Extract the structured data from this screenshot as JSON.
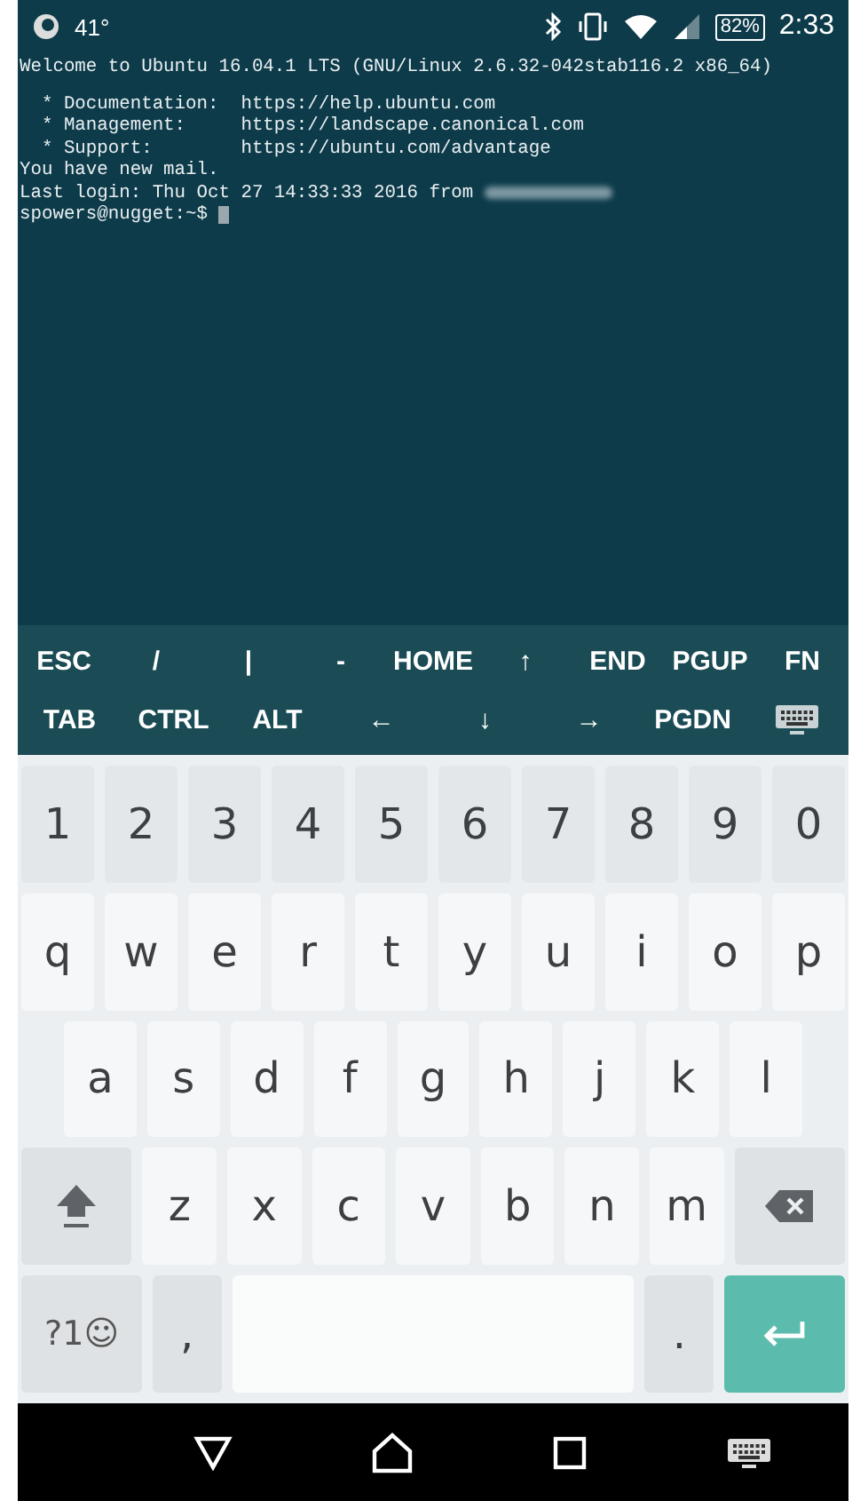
{
  "status_bar": {
    "temperature": "41°",
    "battery": "82%",
    "time": "2:33"
  },
  "terminal": {
    "welcome": "Welcome to Ubuntu 16.04.1 LTS (GNU/Linux 2.6.32-042stab116.2 x86_64)",
    "lines": [
      "  * Documentation:  https://help.ubuntu.com",
      "  * Management:     https://landscape.canonical.com",
      "  * Support:        https://ubuntu.com/advantage",
      "You have new mail."
    ],
    "last_login": "Last login: Thu Oct 27 14:33:33 2016 from",
    "prompt": "spowers@nugget:~$"
  },
  "extra_keys": [
    [
      "ESC",
      "/",
      "|",
      "-",
      "HOME",
      "↑",
      "END",
      "PGUP",
      "FN"
    ],
    [
      "TAB",
      "CTRL",
      "ALT",
      "←",
      "↓",
      "→",
      "PGDN"
    ]
  ],
  "keyboard": [
    [
      {
        "kind": "char",
        "label": "1"
      },
      {
        "kind": "char",
        "label": "2"
      },
      {
        "kind": "char",
        "label": "3"
      },
      {
        "kind": "char",
        "label": "4"
      },
      {
        "kind": "char",
        "label": "5"
      },
      {
        "kind": "char",
        "label": "6"
      },
      {
        "kind": "char",
        "label": "7"
      },
      {
        "kind": "char",
        "label": "8"
      },
      {
        "kind": "char",
        "label": "9"
      },
      {
        "kind": "char",
        "label": "0"
      }
    ],
    [
      {
        "kind": "char",
        "label": "q"
      },
      {
        "kind": "char",
        "label": "w"
      },
      {
        "kind": "char",
        "label": "e"
      },
      {
        "kind": "char",
        "label": "r"
      },
      {
        "kind": "char",
        "label": "t"
      },
      {
        "kind": "char",
        "label": "y"
      },
      {
        "kind": "char",
        "label": "u"
      },
      {
        "kind": "char",
        "label": "i"
      },
      {
        "kind": "char",
        "label": "o"
      },
      {
        "kind": "char",
        "label": "p"
      }
    ],
    [
      {
        "kind": "char",
        "label": "a"
      },
      {
        "kind": "char",
        "label": "s"
      },
      {
        "kind": "char",
        "label": "d"
      },
      {
        "kind": "char",
        "label": "f"
      },
      {
        "kind": "char",
        "label": "g"
      },
      {
        "kind": "char",
        "label": "h"
      },
      {
        "kind": "char",
        "label": "j"
      },
      {
        "kind": "char",
        "label": "k"
      },
      {
        "kind": "char",
        "label": "l"
      }
    ],
    [
      {
        "kind": "shift"
      },
      {
        "kind": "char",
        "label": "z"
      },
      {
        "kind": "char",
        "label": "x"
      },
      {
        "kind": "char",
        "label": "c"
      },
      {
        "kind": "char",
        "label": "v"
      },
      {
        "kind": "char",
        "label": "b"
      },
      {
        "kind": "char",
        "label": "n"
      },
      {
        "kind": "char",
        "label": "m"
      },
      {
        "kind": "backspace"
      }
    ],
    [
      {
        "kind": "symbols",
        "label": "?1☺"
      },
      {
        "kind": "punct",
        "label": ","
      },
      {
        "kind": "space"
      },
      {
        "kind": "punct",
        "label": "."
      },
      {
        "kind": "enter"
      }
    ]
  ]
}
